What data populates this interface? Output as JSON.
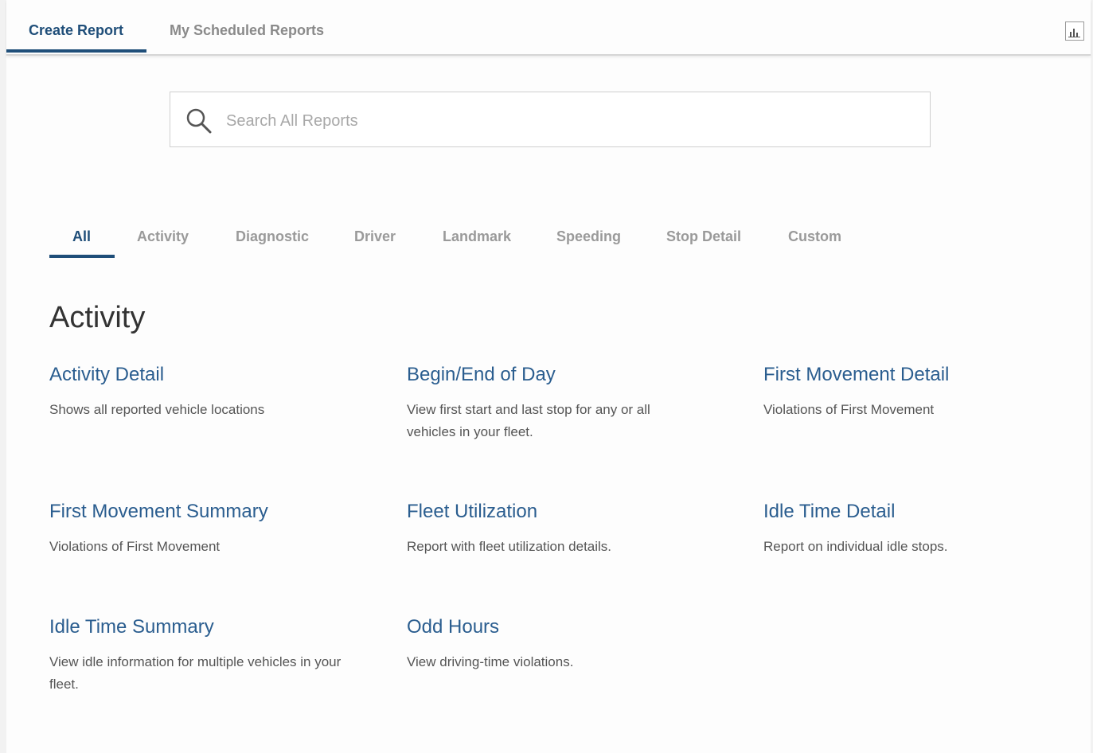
{
  "top_tabs": [
    {
      "label": "Create Report",
      "active": true
    },
    {
      "label": "My Scheduled Reports",
      "active": false
    }
  ],
  "search": {
    "placeholder": "Search All Reports",
    "value": ""
  },
  "category_tabs": [
    {
      "label": "All",
      "active": true
    },
    {
      "label": "Activity",
      "active": false
    },
    {
      "label": "Diagnostic",
      "active": false
    },
    {
      "label": "Driver",
      "active": false
    },
    {
      "label": "Landmark",
      "active": false
    },
    {
      "label": "Speeding",
      "active": false
    },
    {
      "label": "Stop Detail",
      "active": false
    },
    {
      "label": "Custom",
      "active": false
    }
  ],
  "section": {
    "title": "Activity",
    "reports": [
      {
        "title": "Activity Detail",
        "description": "Shows all reported vehicle locations"
      },
      {
        "title": "Begin/End of Day",
        "description": "View first start and last stop for any or all vehicles in your fleet."
      },
      {
        "title": "First Movement Detail",
        "description": "Violations of First Movement"
      },
      {
        "title": "First Movement Summary",
        "description": "Violations of First Movement"
      },
      {
        "title": "Fleet Utilization",
        "description": "Report with fleet utilization details."
      },
      {
        "title": "Idle Time Detail",
        "description": "Report on individual idle stops."
      },
      {
        "title": "Idle Time Summary",
        "description": "View idle information for multiple vehicles in your fleet."
      },
      {
        "title": "Odd Hours",
        "description": "View driving-time violations."
      }
    ]
  },
  "icons": {
    "report_chart": "bar-chart-icon",
    "search": "search-icon"
  },
  "colors": {
    "accent": "#1f4e79",
    "link": "#2a5d8f",
    "inactive_tab": "#9a9a9a"
  }
}
